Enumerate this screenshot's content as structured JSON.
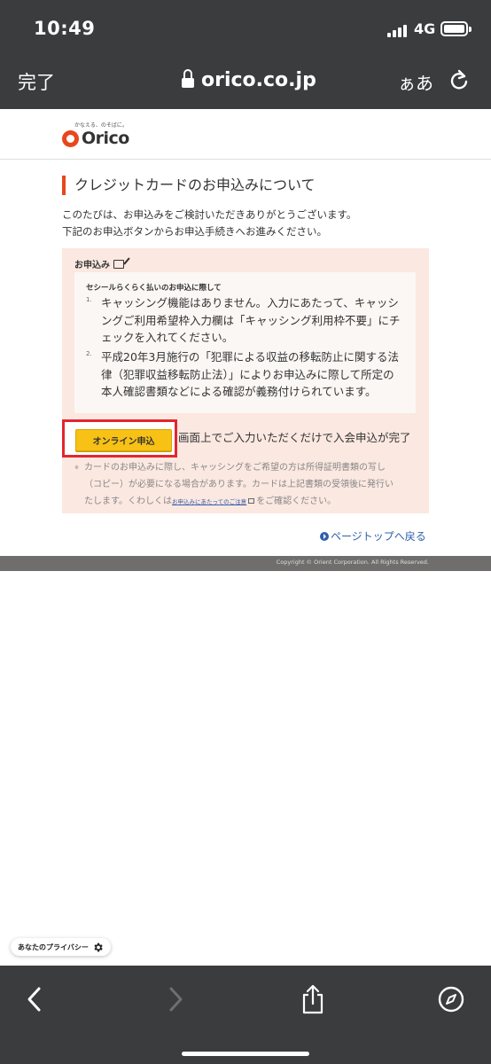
{
  "status": {
    "time": "10:49",
    "network": "4G"
  },
  "browser": {
    "done_label": "完了",
    "url": "orico.co.jp",
    "text_size_label": "ぁあ"
  },
  "site": {
    "logo_tagline": "かなえる、のそばに。",
    "logo_text": "Orico"
  },
  "page": {
    "heading": "クレジットカードのお申込みについて",
    "intro_lines": [
      "このたびは、お申込みをご検討いただきありがとうございます。",
      "下記のお申込ボタンからお申込手続きへお進みください。"
    ],
    "apply_title": "お申込み",
    "notice": {
      "title": "セシールらくらく払いのお申込に際して",
      "items": [
        {
          "num": "1.",
          "lines": [
            "キャッシング機能はありません。入力にあたって、キャッシ",
            "ングご利用希望枠入力欄は「キャッシング利用枠不要」にチ",
            "ェックを入れてください。"
          ]
        },
        {
          "num": "2.",
          "lines": [
            "平成20年3月施行の「犯罪による収益の移転防止に関する法",
            "律（犯罪収益移転防止法）」によりお申込みに際して所定の",
            "本人確認書類などによる確認が義務付けられています。"
          ]
        }
      ]
    },
    "online_button": "オンライン申込",
    "button_desc": "画面上でご入力いただくだけで入会申込が完了",
    "footnote": {
      "mark": "※",
      "line1": "カードのお申込みに際し、キャッシングをご希望の方は所得証明書類の写し",
      "line2": "（コピー）が必要になる場合があります。カードは上記書類の受領後に発行い",
      "line3_pre": "たします。くわしくは",
      "link": "お申込みにあたってのご注意",
      "line3_post": "をご確認ください。"
    },
    "page_top": "ページトップへ戻る",
    "copyright": "Copyright © Orient Corporation. All Rights Reserved.",
    "privacy": "あなたのプライバシー"
  },
  "colors": {
    "chrome": "#3b3c3e",
    "brand_orange": "#e8471d",
    "button_yellow": "#f7c115",
    "highlight_red": "#e3262e",
    "box_pink": "#fbe8e1",
    "link_blue": "#2f5fab"
  },
  "icons": [
    "lock-icon",
    "reload-icon",
    "pen-icon",
    "external-link-icon",
    "page-top-icon",
    "gear-icon",
    "back-icon",
    "forward-icon",
    "share-icon",
    "compass-icon"
  ]
}
